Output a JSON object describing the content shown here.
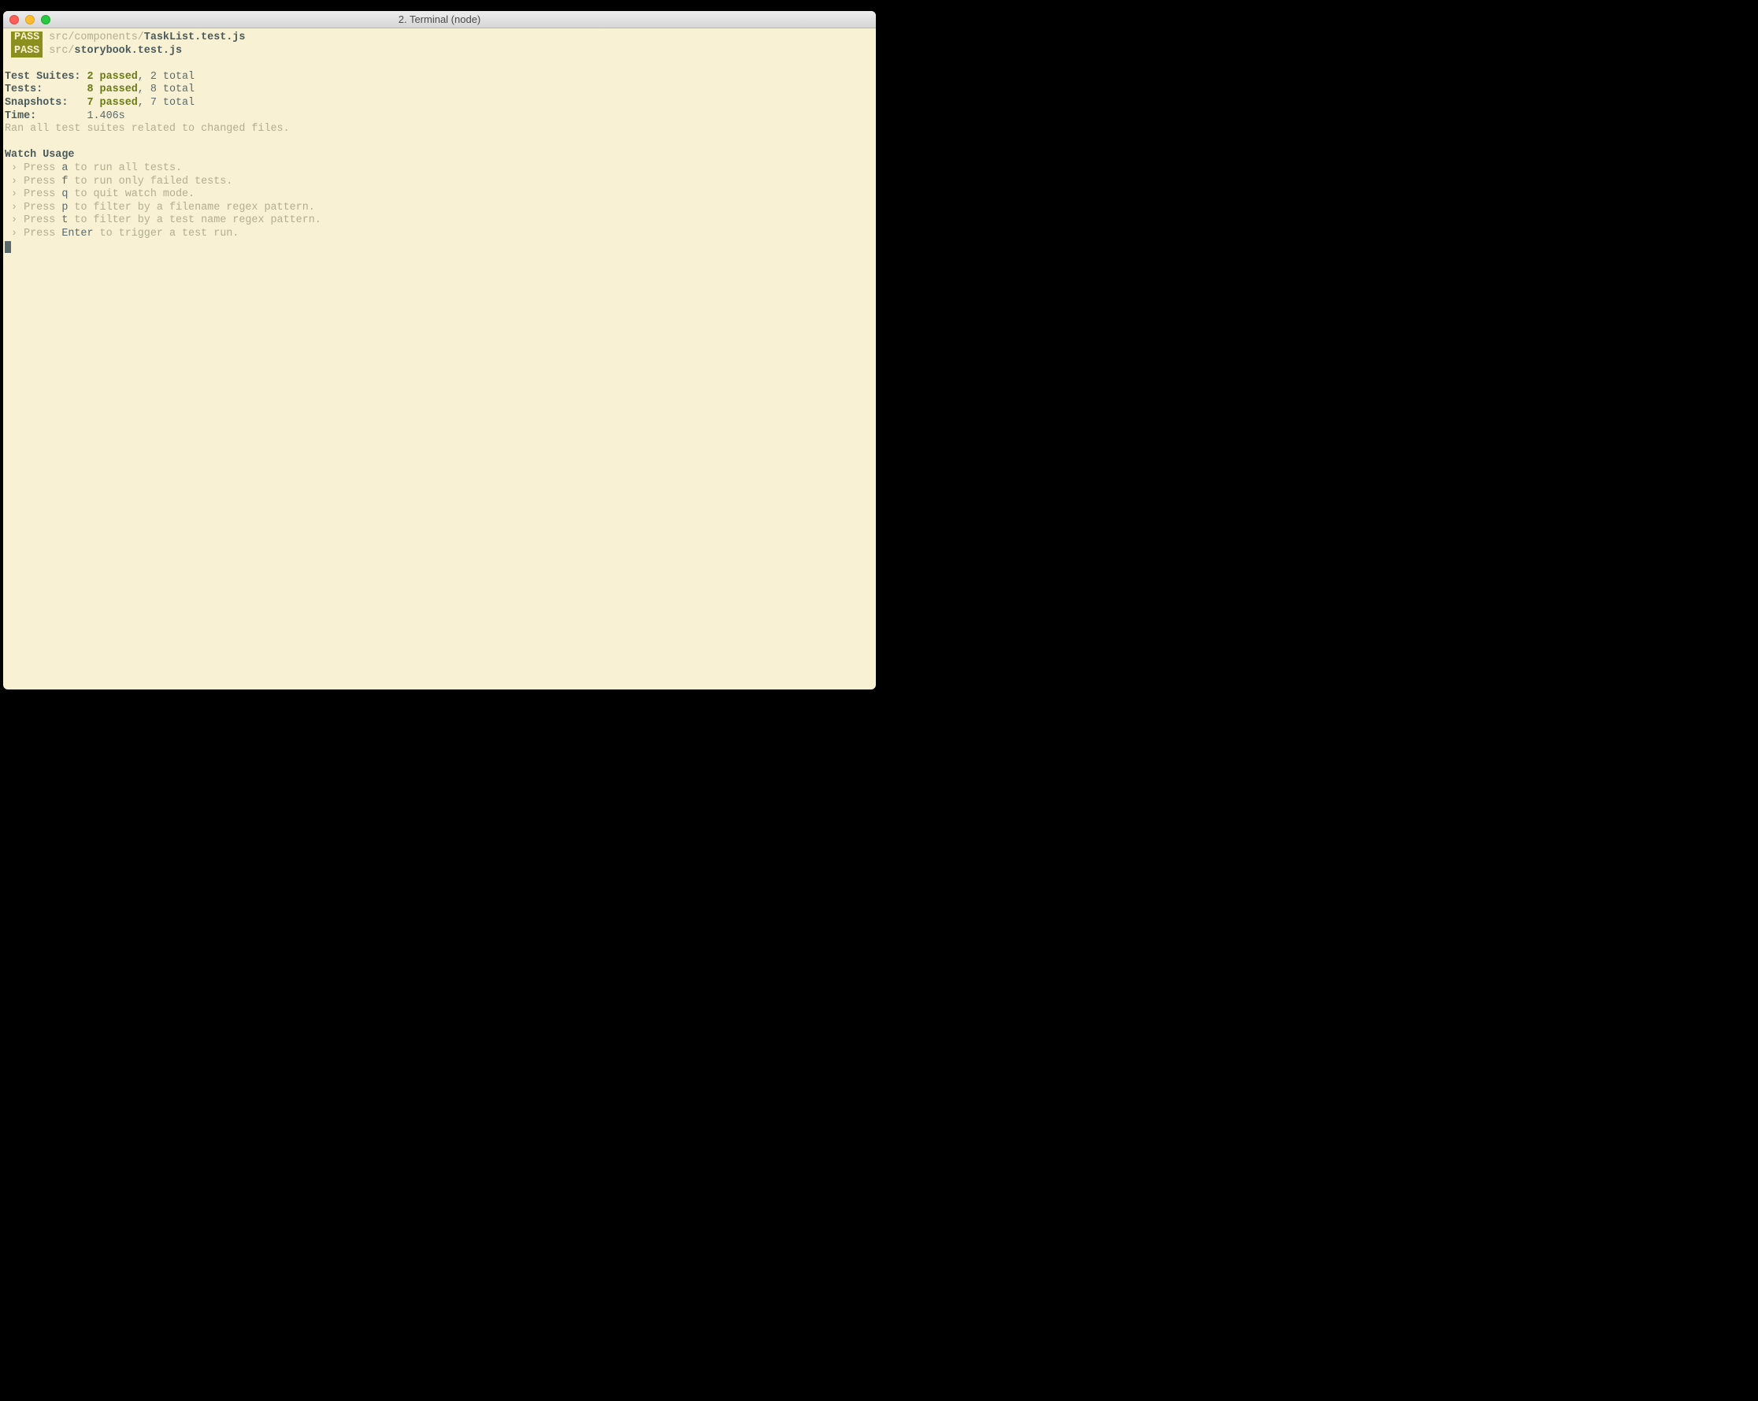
{
  "window": {
    "title": "2. Terminal (node)"
  },
  "pass_label": "PASS",
  "tests": [
    {
      "dir": "src/components/",
      "file": "TaskList.test.js"
    },
    {
      "dir": "src/",
      "file": "storybook.test.js"
    }
  ],
  "summary": {
    "suites_label": "Test Suites: ",
    "suites_passed_n": "2",
    "suites_passed_w": " passed",
    "suites_rest": ", 2 total",
    "tests_label": "Tests:       ",
    "tests_passed_n": "8",
    "tests_passed_w": " passed",
    "tests_rest": ", 8 total",
    "snaps_label": "Snapshots:   ",
    "snaps_passed_n": "7",
    "snaps_passed_w": " passed",
    "snaps_rest": ", 7 total",
    "time_label": "Time:        ",
    "time_value": "1.406s",
    "ran_msg": "Ran all test suites related to changed files."
  },
  "watch": {
    "heading": "Watch Usage",
    "items": [
      {
        "pre": " › Press ",
        "key": "a",
        "post": " to run all tests."
      },
      {
        "pre": " › Press ",
        "key": "f",
        "post": " to run only failed tests."
      },
      {
        "pre": " › Press ",
        "key": "q",
        "post": " to quit watch mode."
      },
      {
        "pre": " › Press ",
        "key": "p",
        "post": " to filter by a filename regex pattern."
      },
      {
        "pre": " › Press ",
        "key": "t",
        "post": " to filter by a test name regex pattern."
      },
      {
        "pre": " › Press ",
        "key": "Enter",
        "post": " to trigger a test run."
      }
    ]
  }
}
